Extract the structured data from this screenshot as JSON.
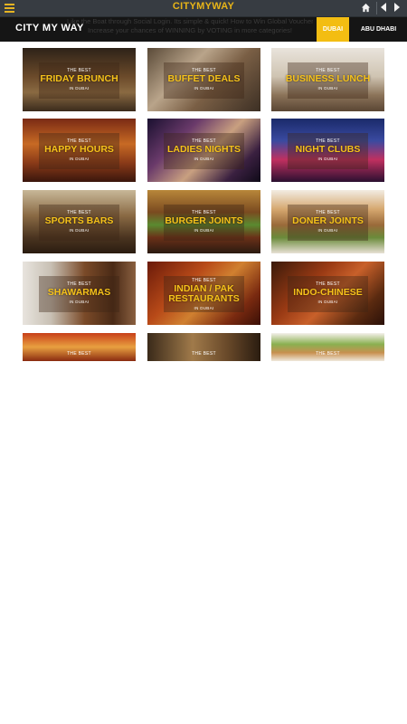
{
  "app": {
    "title": "CITYMYWAY"
  },
  "header": {
    "brand": "CITY MY WAY",
    "marquee_line1": "Like the Boat through Social Login. Its simple & quick! How to Win Global Vouchers!",
    "marquee_line2": "Increase your chances of WINNING by VOTING in more categories!",
    "tabs": [
      "DUBAI",
      "ABU DHABI"
    ]
  },
  "tiles": [
    {
      "best": "THE BEST",
      "name": "FRIDAY BRUNCH",
      "city": "IN DUBAI"
    },
    {
      "best": "THE BEST",
      "name": "BUFFET DEALS",
      "city": "IN DUBAI"
    },
    {
      "best": "THE BEST",
      "name": "BUSINESS LUNCH",
      "city": "IN DUBAI"
    },
    {
      "best": "THE BEST",
      "name": "HAPPY HOURS",
      "city": "IN DUBAI"
    },
    {
      "best": "THE BEST",
      "name": "LADIES NIGHTS",
      "city": "IN DUBAI"
    },
    {
      "best": "THE BEST",
      "name": "NIGHT CLUBS",
      "city": "IN DUBAI"
    },
    {
      "best": "THE BEST",
      "name": "SPORTS BARS",
      "city": "IN DUBAI"
    },
    {
      "best": "THE BEST",
      "name": "BURGER JOINTS",
      "city": "IN DUBAI"
    },
    {
      "best": "THE BEST",
      "name": "DONER JOINTS",
      "city": "IN DUBAI"
    },
    {
      "best": "THE BEST",
      "name": "SHAWARMAS",
      "city": "IN DUBAI"
    },
    {
      "best": "THE BEST",
      "name": "INDIAN / PAK RESTAURANTS",
      "city": "IN DUBAI"
    },
    {
      "best": "THE BEST",
      "name": "INDO-CHINESE",
      "city": "IN DUBAI"
    },
    {
      "best": "THE BEST"
    },
    {
      "best": "THE BEST"
    },
    {
      "best": "THE BEST"
    }
  ],
  "colors": {
    "accent": "#f3bd12",
    "topbar": "#373c42",
    "header": "#151515"
  }
}
